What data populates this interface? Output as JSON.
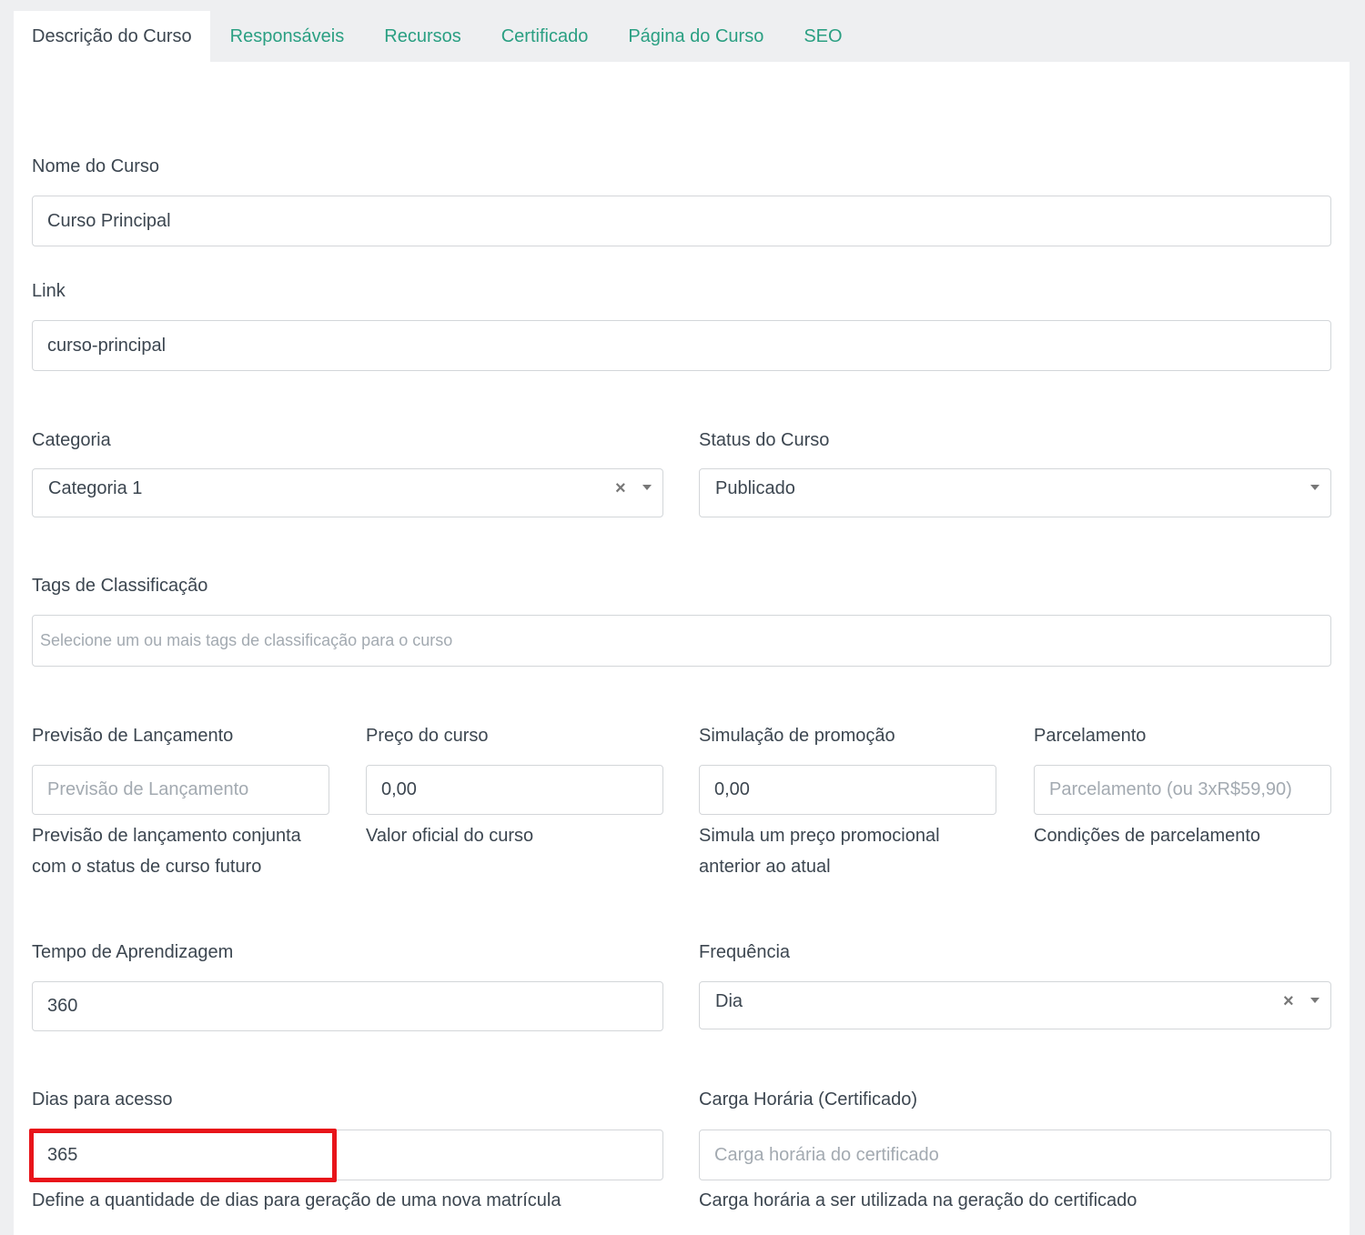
{
  "tabs": [
    {
      "label": "Descrição do Curso",
      "active": true
    },
    {
      "label": "Responsáveis",
      "active": false
    },
    {
      "label": "Recursos",
      "active": false
    },
    {
      "label": "Certificado",
      "active": false
    },
    {
      "label": "Página do Curso",
      "active": false
    },
    {
      "label": "SEO",
      "active": false
    }
  ],
  "form": {
    "nome": {
      "label": "Nome do Curso",
      "value": "Curso Principal"
    },
    "link": {
      "label": "Link",
      "value": "curso-principal"
    },
    "categoria": {
      "label": "Categoria",
      "value": "Categoria 1"
    },
    "status": {
      "label": "Status do Curso",
      "value": "Publicado"
    },
    "tags": {
      "label": "Tags de Classificação",
      "placeholder": "Selecione um ou mais tags de classificação para o curso"
    },
    "previsao": {
      "label": "Previsão de Lançamento",
      "placeholder": "Previsão de Lançamento",
      "help": "Previsão de lançamento conjunta com o status de curso futuro"
    },
    "preco": {
      "label": "Preço do curso",
      "value": "0,00",
      "help": "Valor oficial do curso"
    },
    "promocao": {
      "label": "Simulação de promoção",
      "value": "0,00",
      "help": "Simula um preço promocional anterior ao atual"
    },
    "parcelamento": {
      "label": "Parcelamento",
      "placeholder": "Parcelamento (ou 3xR$59,90)",
      "help": "Condições de parcelamento"
    },
    "tempo": {
      "label": "Tempo de Aprendizagem",
      "value": "360"
    },
    "frequencia": {
      "label": "Frequência",
      "value": "Dia"
    },
    "dias": {
      "label": "Dias para acesso",
      "value": "365",
      "help": "Define a quantidade de dias para geração de uma nova matrícula"
    },
    "carga": {
      "label": "Carga Horária (Certificado)",
      "placeholder": "Carga horária do certificado",
      "help": "Carga horária a ser utilizada na geração do certificado"
    }
  },
  "icons": {
    "clear": "clear-x-icon",
    "dropdown": "dropdown-caret-icon"
  },
  "colors": {
    "tab_link": "#2a9f82",
    "highlight": "#e8141a",
    "text": "#3c4650",
    "placeholder": "#a3aab1"
  }
}
